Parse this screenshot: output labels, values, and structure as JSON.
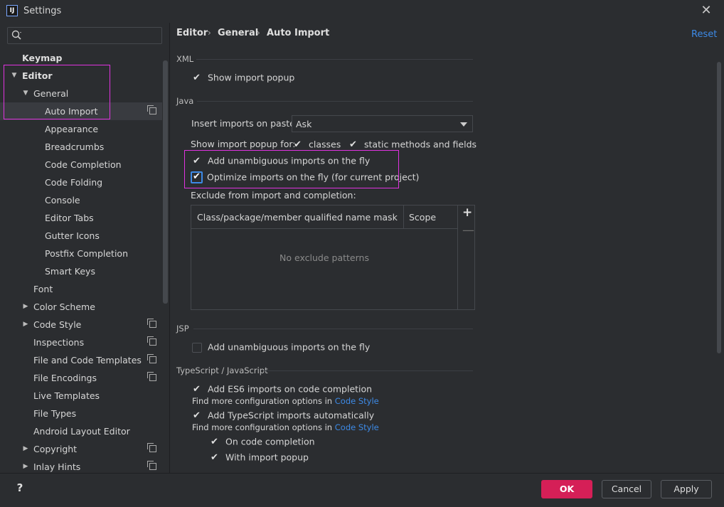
{
  "window": {
    "title": "Settings",
    "logo_text": "IJ"
  },
  "search": {
    "placeholder": "",
    "value": ""
  },
  "tree": {
    "items": [
      {
        "label": "Keymap"
      },
      {
        "label": "Editor"
      },
      {
        "label": "General"
      },
      {
        "label": "Auto Import"
      },
      {
        "label": "Appearance"
      },
      {
        "label": "Breadcrumbs"
      },
      {
        "label": "Code Completion"
      },
      {
        "label": "Code Folding"
      },
      {
        "label": "Console"
      },
      {
        "label": "Editor Tabs"
      },
      {
        "label": "Gutter Icons"
      },
      {
        "label": "Postfix Completion"
      },
      {
        "label": "Smart Keys"
      },
      {
        "label": "Font"
      },
      {
        "label": "Color Scheme"
      },
      {
        "label": "Code Style"
      },
      {
        "label": "Inspections"
      },
      {
        "label": "File and Code Templates"
      },
      {
        "label": "File Encodings"
      },
      {
        "label": "Live Templates"
      },
      {
        "label": "File Types"
      },
      {
        "label": "Android Layout Editor"
      },
      {
        "label": "Copyright"
      },
      {
        "label": "Inlay Hints"
      }
    ]
  },
  "breadcrumb": {
    "items": [
      "Editor",
      "General",
      "Auto Import"
    ],
    "separator": "›"
  },
  "reset_label": "Reset",
  "xml": {
    "title": "XML",
    "show_popup": "Show import popup"
  },
  "java": {
    "title": "Java",
    "insert_label": "Insert imports on paste:",
    "insert_value": "Ask",
    "popup_for_label": "Show import popup for:",
    "classes": "classes",
    "static": "static methods and fields",
    "add_unambiguous": "Add unambiguous imports on the fly",
    "optimize": "Optimize imports on the fly (for current project)",
    "exclude_label": "Exclude from import and completion:",
    "table": {
      "col1": "Class/package/member qualified name mask",
      "col2": "Scope",
      "empty": "No exclude patterns"
    }
  },
  "jsp": {
    "title": "JSP",
    "add_unambiguous": "Add unambiguous imports on the fly"
  },
  "ts": {
    "title": "TypeScript / JavaScript",
    "es6": "Add ES6 imports on code completion",
    "more_text": "Find more configuration options in",
    "more_link": "Code Style",
    "ts_auto": "Add TypeScript imports automatically",
    "more_text2": "Find more configuration options in",
    "more_link2": "Code Style",
    "on_completion": "On code completion",
    "with_popup": "With import popup"
  },
  "footer": {
    "help": "?",
    "ok": "OK",
    "cancel": "Cancel",
    "apply": "Apply"
  },
  "colors": {
    "accent": "#3d8ae6",
    "ok_button": "#d51f57",
    "highlight": "#e033e0",
    "background": "#2b2d30"
  }
}
